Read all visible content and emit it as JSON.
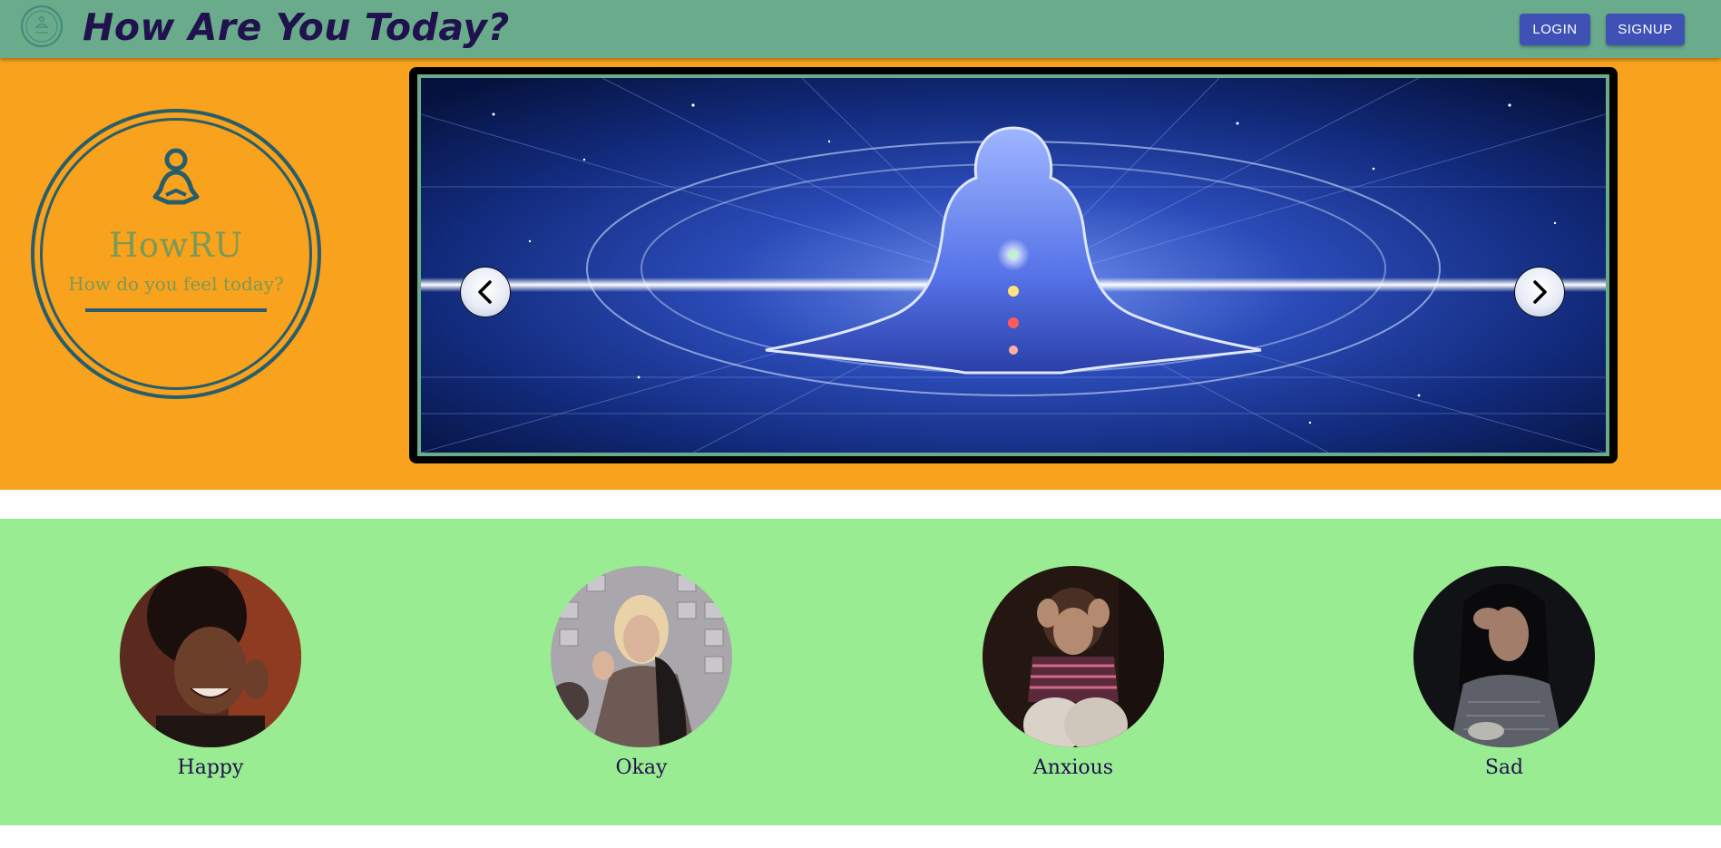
{
  "header": {
    "title": "How Are You Today?",
    "login_label": "LOGIN",
    "signup_label": "SIGNUP"
  },
  "brand": {
    "name": "HowRU",
    "tagline": "How do you feel today?"
  },
  "carousel": {
    "prev_icon": "chevron-left-icon",
    "next_icon": "chevron-right-icon"
  },
  "moods": [
    {
      "label": "Happy"
    },
    {
      "label": "Okay"
    },
    {
      "label": "Anxious"
    },
    {
      "label": "Sad"
    }
  ],
  "colors": {
    "navbar": "#6aab8c",
    "hero": "#f8a21d",
    "moods_bg": "#9aec92",
    "button": "#3f51b5",
    "title": "#20124d"
  }
}
